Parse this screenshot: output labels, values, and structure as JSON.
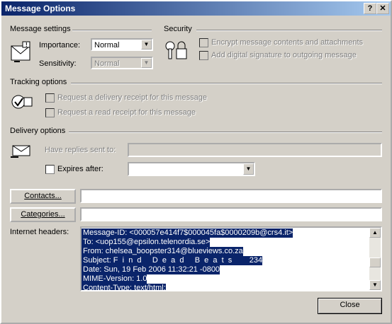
{
  "window": {
    "title": "Message Options",
    "help_btn": "?",
    "close_btn": "✕"
  },
  "message_settings": {
    "heading": "Message settings",
    "importance_label": "Importance:",
    "importance_value": "Normal",
    "sensitivity_label": "Sensitivity:",
    "sensitivity_value": "Normal"
  },
  "security": {
    "heading": "Security",
    "encrypt_label": "Encrypt message contents and attachments",
    "signature_label": "Add digital signature to outgoing message"
  },
  "tracking": {
    "heading": "Tracking options",
    "delivery_receipt_label": "Request a delivery receipt for this message",
    "read_receipt_label": "Request a read receipt for this message"
  },
  "delivery": {
    "heading": "Delivery options",
    "replies_label": "Have replies sent to:",
    "expires_label": "Expires after:",
    "expires_value": ""
  },
  "contacts_button": "Contacts...",
  "categories_button": "Categories...",
  "contacts_value": "",
  "categories_value": "",
  "internet_headers": {
    "label": "Internet headers:",
    "lines": [
      "Message-ID: <000057e414f7$000045fa$0000209b@crs4.it>",
      "To: <uop155@epsilon.telenordia.se>",
      "From: chelsea_boopster314@blueviews.co.za",
      "Subject: F  i  n  d     D  e  a  d     B  e  a  t  s        234",
      "Date: Sun, 19 Feb 2006 11:32:21 -0800",
      "MIME-Version: 1.0",
      "Content-Type: text/html;"
    ]
  },
  "close_button": "Close"
}
